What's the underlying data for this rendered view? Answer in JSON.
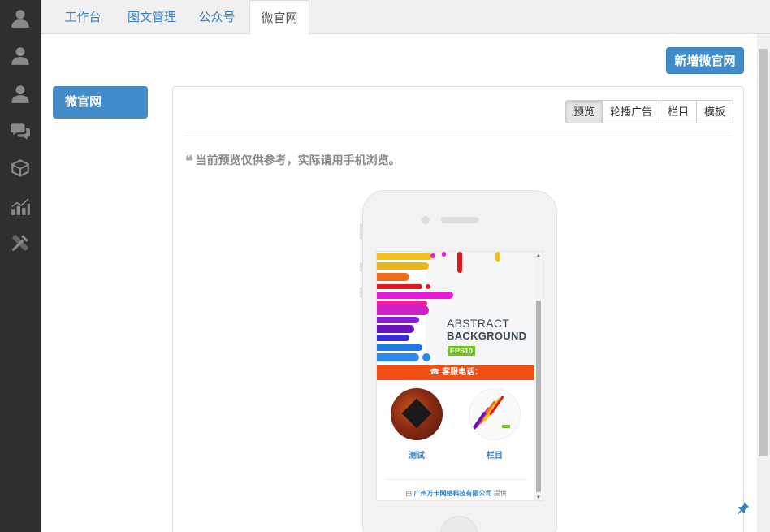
{
  "sidebar": {
    "items": [
      {
        "icon": "user-icon"
      },
      {
        "icon": "user-icon"
      },
      {
        "icon": "user-icon"
      },
      {
        "icon": "chat-bubbles-icon"
      },
      {
        "icon": "box-icon"
      },
      {
        "icon": "chart-icon"
      },
      {
        "icon": "tools-icon"
      }
    ]
  },
  "tabs": [
    {
      "label": "工作台"
    },
    {
      "label": "图文管理"
    },
    {
      "label": "公众号"
    },
    {
      "label": "微官网",
      "active": true
    }
  ],
  "toolbar": {
    "new_site_label": "新增微官网"
  },
  "side_nav": {
    "active_label": "微官网"
  },
  "panel": {
    "buttons": [
      {
        "label": "预览",
        "active": true
      },
      {
        "label": "轮播广告"
      },
      {
        "label": "栏目"
      },
      {
        "label": "模板"
      }
    ],
    "note": "当前预览仅供参考，实际请用手机浏览。"
  },
  "preview": {
    "banner": {
      "line1": "ABSTRACT",
      "line2": "BACKGROUND",
      "badge": "EPS10"
    },
    "hotline_label": "客服电话：",
    "tiles": [
      {
        "label": "测试"
      },
      {
        "label": "栏目"
      }
    ],
    "footer": {
      "prefix": "由",
      "company": "广州万卡网络科技有限公司",
      "suffix": "提供"
    }
  },
  "colors": {
    "rail_bg": "#2f2f2f",
    "primary": "#428bca",
    "link": "#3a7fc2",
    "hotline_bg": "#f04e12"
  }
}
